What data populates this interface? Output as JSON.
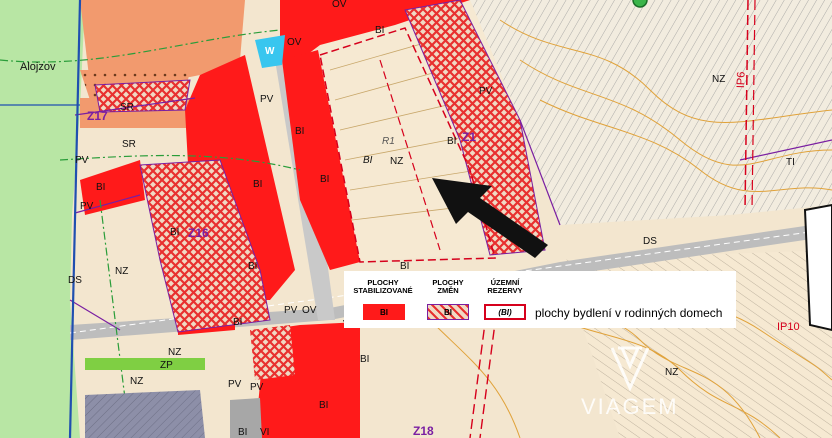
{
  "map": {
    "labels": {
      "alojzov": "Alojzov",
      "sr1": "SR",
      "sr2": "SR",
      "pv1": "PV",
      "pv2": "PV",
      "pv3": "PV",
      "pv4": "PV",
      "pv5": "PV",
      "pv6": "PV",
      "pv7": "PV",
      "bi1": "BI",
      "bi2": "BI",
      "bi3": "BI",
      "bi4": "BI",
      "bi5": "BI",
      "bi6": "BI",
      "bi7": "BI",
      "bi8": "BI",
      "bi9": "BI",
      "bi10": "BI",
      "bi11": "BI",
      "bi12": "BI",
      "bi13": "BI",
      "nz1": "NZ",
      "nz2": "NZ",
      "nz3": "NZ",
      "nz4": "NZ",
      "nz5": "NZ",
      "nz6": "NZ",
      "ds1": "DS",
      "ds2": "DS",
      "ov1": "OV",
      "ov2": "OV",
      "ov3": "OV",
      "w": "W",
      "vd": "VD",
      "zp": "ZP",
      "vi": "VI",
      "ti": "TI",
      "r1": "R1",
      "bi_ital": "BI",
      "z1": "Z1",
      "z16": "Z16",
      "z17": "Z17",
      "z18": "Z18",
      "ip6": "IP6",
      "ip10": "IP10"
    },
    "colors": {
      "stabilized": "#ff1a1a",
      "change": "#e8302f",
      "forest": "#b8e6a4",
      "garden": "#f29a6e",
      "transport": "#bdbdbd",
      "water": "#38c6ef",
      "zone_outline": "#7a1fa2",
      "reserve": "#d6001c"
    }
  },
  "legend": {
    "stabilized_header": "PLOCHY STABILIZOVANÉ",
    "change_header": "PLOCHY ZMĚN",
    "reserve_header": "ÚZEMNÍ REZERVY",
    "stabilized_code": "BI",
    "change_code": "BI",
    "reserve_code": "(BI)",
    "description": "plochy bydlení v rodinných domech"
  },
  "watermark": {
    "text": "VIAGEM"
  }
}
